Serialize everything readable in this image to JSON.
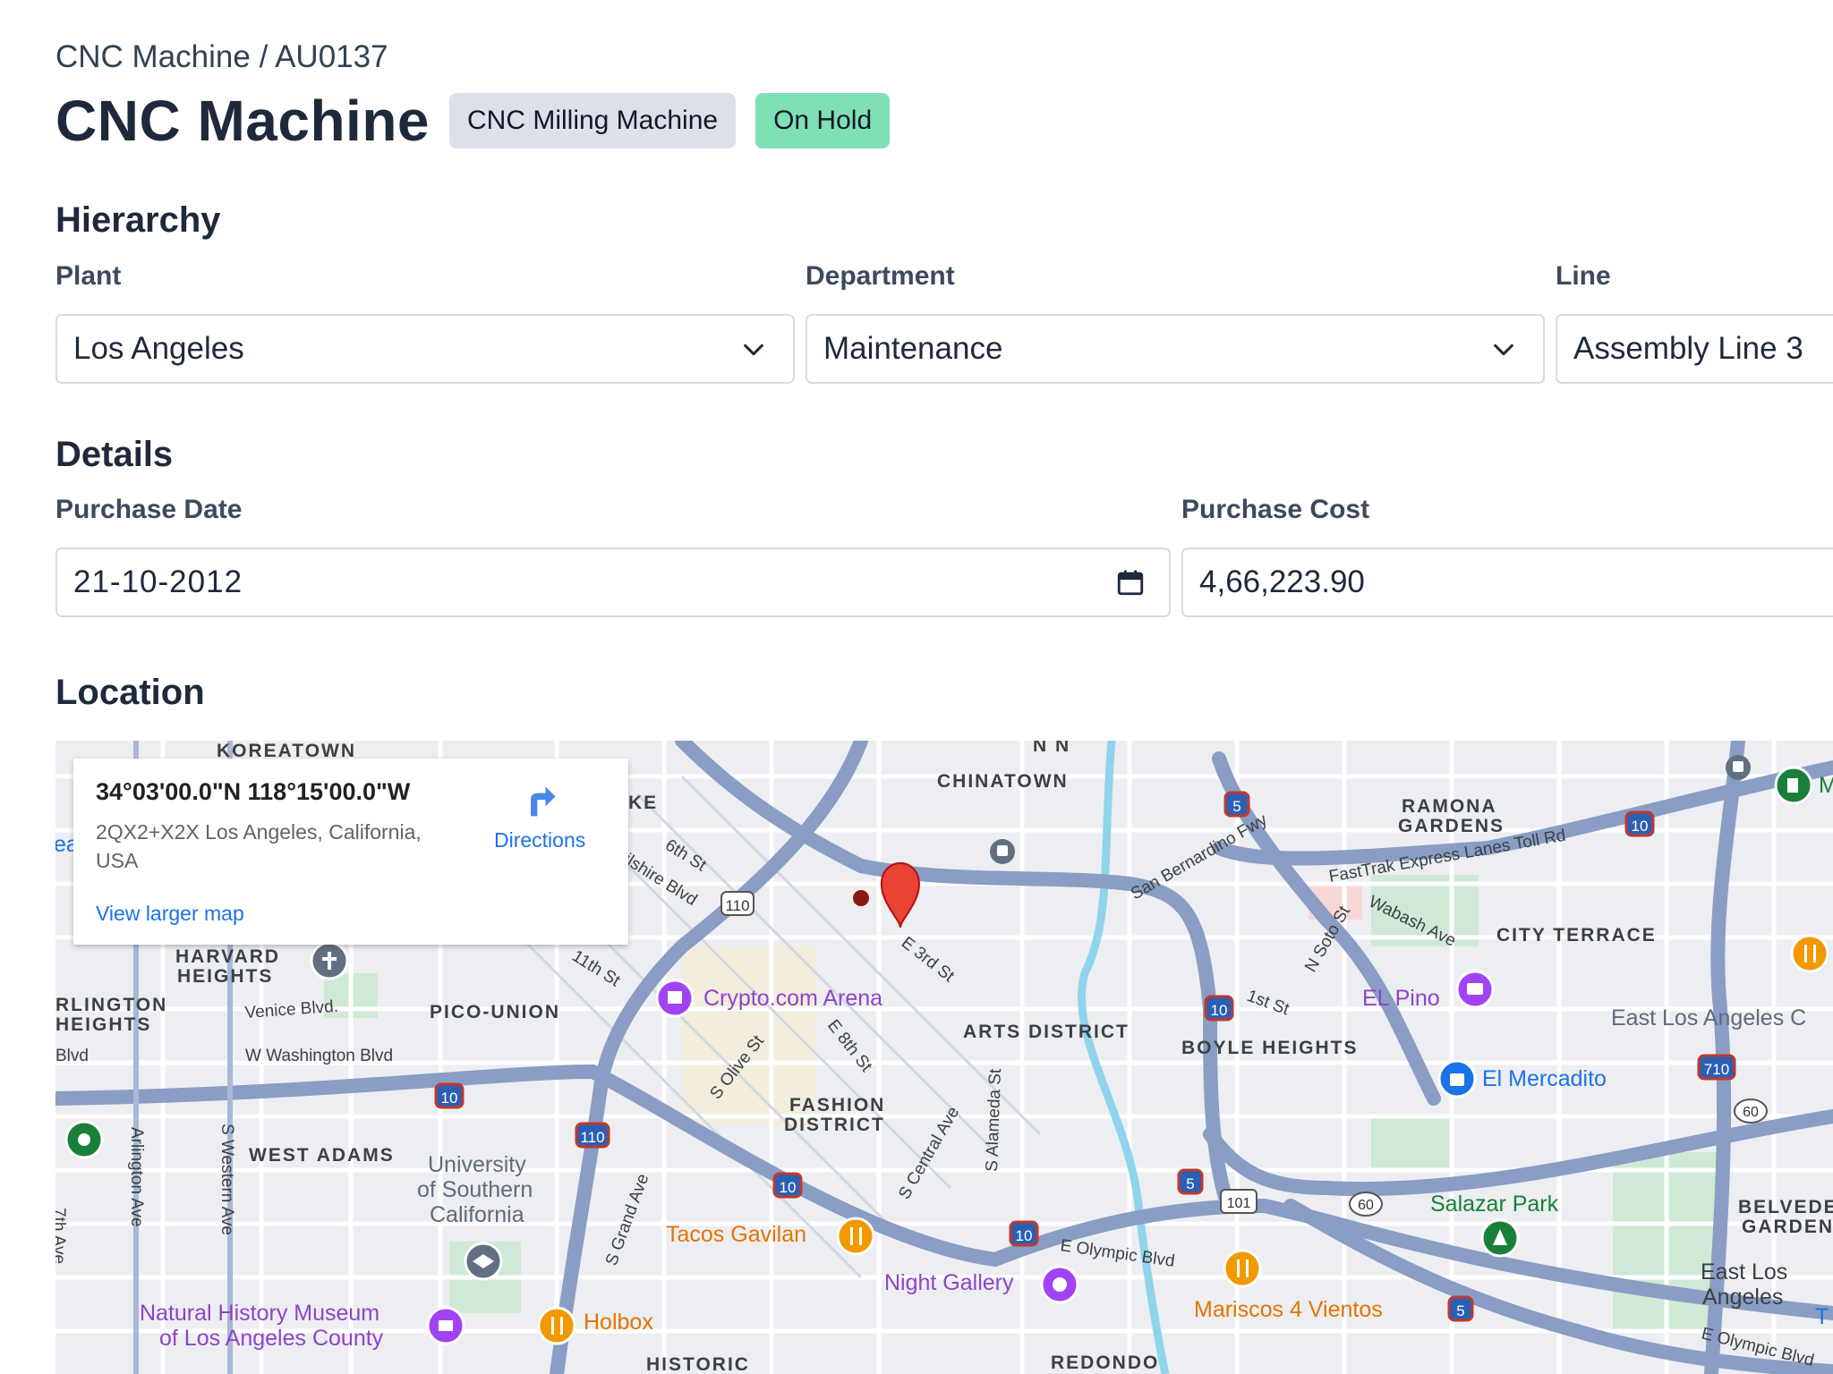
{
  "breadcrumb": "CNC Machine / AU0137",
  "title": "CNC Machine",
  "badges": {
    "type": "CNC Milling Machine",
    "status": "On Hold"
  },
  "hierarchy": {
    "heading": "Hierarchy",
    "plant": {
      "label": "Plant",
      "value": "Los Angeles"
    },
    "department": {
      "label": "Department",
      "value": "Maintenance"
    },
    "line": {
      "label": "Line",
      "value": "Assembly Line 3"
    }
  },
  "details": {
    "heading": "Details",
    "purchase_date": {
      "label": "Purchase Date",
      "value": "21-10-2012"
    },
    "purchase_cost": {
      "label": "Purchase Cost",
      "value": "4,66,223.90"
    }
  },
  "location": {
    "heading": "Location",
    "card": {
      "coords": "34°03'00.0\"N 118°15'00.0\"W",
      "address": "2QX2+X2X Los Angeles, California, USA",
      "directions": "Directions",
      "view_larger": "View larger map"
    },
    "map_labels": {
      "chinatown": "CHINATOWN",
      "ramona": "RAMONA",
      "gardens": "GARDENS",
      "city_terrace": "CITY TERRACE",
      "harvard": "HARVARD",
      "heights": "HEIGHTS",
      "arlington": "RLINGTON",
      "heights2": "HEIGHTS",
      "pico_union": "PICO-UNION",
      "arts_district": "ARTS DISTRICT",
      "boyle_heights": "BOYLE HEIGHTS",
      "fashion": "FASHION",
      "district": "DISTRICT",
      "west_adams": "WEST ADAMS",
      "belvedere": "BELVEDEF",
      "garden": "GARDEN",
      "historic": "HISTORIC",
      "redondo": "REDONDO",
      "koreatown": "KOREATOWN",
      "ke": "KE",
      "crypto": "Crypto.com Arena",
      "el_pino": "EL Pino",
      "el_mercadito": "El Mercadito",
      "usc1": "University",
      "usc2": "of Southern",
      "usc3": "California",
      "tacos": "Tacos Gavilan",
      "night_gallery": "Night Gallery",
      "salazar": "Salazar Park",
      "mariscos": "Mariscos 4 Vientos",
      "holbox": "Holbox",
      "nhm1": "Natural History Museum",
      "nhm2": "of Los Angeles County",
      "east_la1": "East Los",
      "east_la2": "Angeles",
      "east_la_c": "East Los Angeles C",
      "sixth": "6th St",
      "wilshire": "ilshire Blvd",
      "eleventh": "11th St",
      "e3rd": "E 3rd St",
      "olive": "S Olive St",
      "e8th": "E 8th St",
      "central": "S Central Ave",
      "alameda": "S Alameda St",
      "venice": "Venice Blvd.",
      "washington": "W Washington Blvd",
      "blvd": "Blvd",
      "arlington_ave": "Arlington Ave",
      "western": "S Western Ave",
      "seventh": "7th Ave",
      "grand": "S Grand Ave",
      "olympic": "E Olympic Blvd",
      "olympic2": "E Olympic Blvd",
      "sanbern": "San Bernardino Fwy",
      "fastrak": "FastTrak Express Lanes Toll Rd",
      "soto": "N Soto St",
      "wabash": "Wabash Ave",
      "first": "1st St",
      "i110": "110",
      "i110b": "110",
      "i10a": "10",
      "i10b": "10",
      "i10c": "10",
      "i10d": "10",
      "i10e": "10",
      "i5a": "5",
      "i5b": "5",
      "i5c": "5",
      "i710": "710",
      "r60": "60",
      "r60b": "60",
      "r101": "101",
      "nn": "N N",
      "ea": "ea",
      "m": "M",
      "t": "T",
      "sixth_top": "6th St"
    }
  }
}
